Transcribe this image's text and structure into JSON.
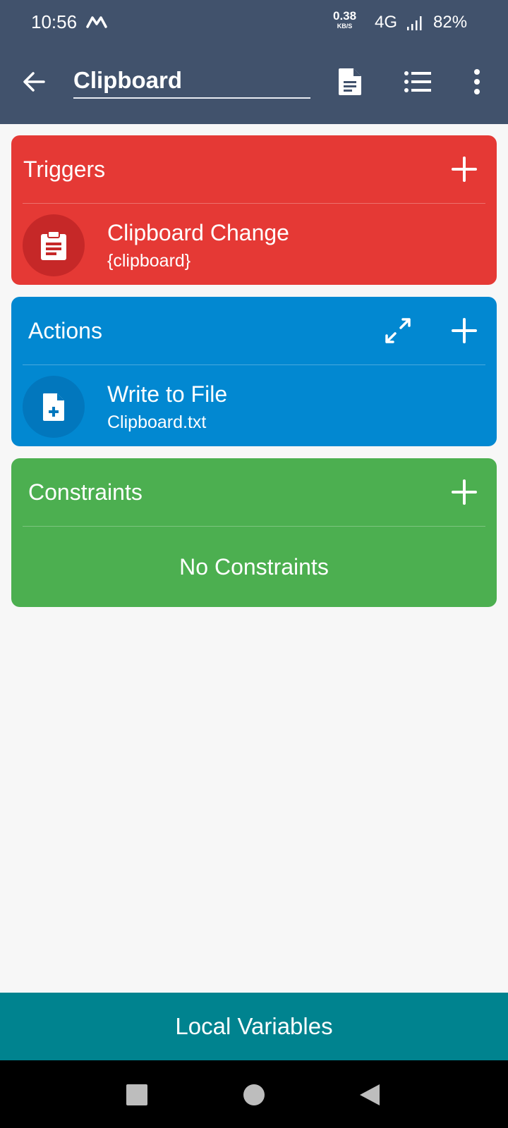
{
  "status": {
    "time": "10:56",
    "net_speed": "0.38",
    "net_unit": "KB/S",
    "network": "4G",
    "battery": "82%"
  },
  "toolbar": {
    "title": "Clipboard",
    "icons": [
      "back-arrow-icon",
      "document-icon",
      "list-icon",
      "more-vert-icon"
    ]
  },
  "triggers": {
    "title": "Triggers",
    "color": "#e53935",
    "items": [
      {
        "title": "Clipboard Change",
        "subtitle": "{clipboard}",
        "icon": "clipboard-icon"
      }
    ]
  },
  "actions": {
    "title": "Actions",
    "color": "#0288d1",
    "items": [
      {
        "title": "Write to File",
        "subtitle": "Clipboard.txt",
        "icon": "file-add-icon"
      }
    ]
  },
  "constraints": {
    "title": "Constraints",
    "color": "#4caf50",
    "empty_text": "No Constraints"
  },
  "bottom": {
    "button_label": "Local Variables",
    "color": "#00838f"
  }
}
